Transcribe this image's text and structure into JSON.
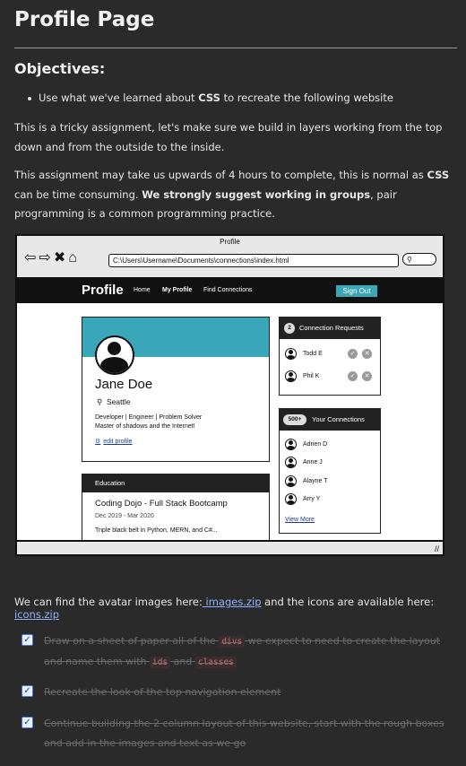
{
  "page": {
    "title": "Profile Page",
    "objectives_heading": "Objectives:",
    "objectives": [
      {
        "before": "Use what we've learned about ",
        "bold": "CSS",
        "after": " to recreate the following website"
      }
    ],
    "para1": "This is a tricky assignment, let's make sure we build in layers working from the top down and from the outside to the inside.",
    "para2": {
      "a": "This assignment may take us upwards of 4 hours to complete, this is normal as ",
      "b": "CSS",
      "c": " can be time consuming. ",
      "d": "We strongly suggest working in groups",
      "e": ", pair programming is a common programming practice."
    },
    "links": {
      "prefix": "We can find the avatar images here:",
      "images_link": " images.zip",
      "middle": " and the icons are available here: ",
      "icons_link": "icons.zip"
    },
    "tasks": [
      {
        "p1": "Draw on a sheet of paper all of the ",
        "code1": "divs",
        "p2": " we expect to need to create the layout and name them with ",
        "code2": "ids",
        "p3": " and ",
        "code3": "classes"
      },
      {
        "p1": "Recreate the look of the top navigation element"
      },
      {
        "p1": "Continue building the 2 column layout of this website, start with the rough boxes and add in the images and text as we go"
      }
    ]
  },
  "mockup": {
    "window_title": "Profile",
    "nav_icons": "⇦⇨✖⌂",
    "address": "C:\\Users\\Username\\Documents\\connections\\index.html",
    "search_icon": "magnifier-icon",
    "logo": "Profile",
    "nav": [
      "Home",
      "My Profile",
      "Find Connections"
    ],
    "signout": "Sign Out",
    "profile": {
      "name": "Jane Doe",
      "location": "Seattle",
      "bio1": "Developer | Engineer | Problem Solver",
      "bio2": "Master of shadows and the Internet!",
      "edit": "edit profile"
    },
    "education": {
      "heading": "Education",
      "title": "Coding Dojo - Full Stack Bootcamp",
      "dates": "Dec 2019 - Mar 2020",
      "desc": "Triple black belt in Python, MERN, and C#..."
    },
    "requests": {
      "count": "2",
      "heading": "Connection Requests",
      "people": [
        "Todd E",
        "Phil K"
      ]
    },
    "connections": {
      "count": "500+",
      "heading": "Your Connections",
      "people": [
        "Adrien D",
        "Anne J",
        "Alayne T",
        "Arry Y"
      ],
      "view_more": "View More"
    },
    "colors": {
      "accent": "#3aa6ba",
      "dark": "#222222"
    }
  }
}
